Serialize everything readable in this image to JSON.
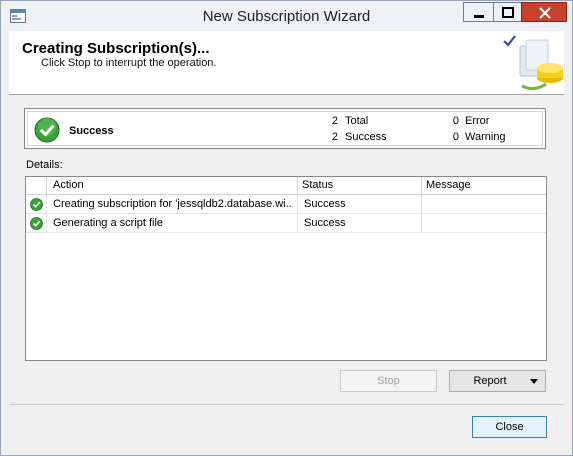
{
  "window": {
    "title": "New Subscription Wizard"
  },
  "header": {
    "title": "Creating Subscription(s)...",
    "subtitle": "Click Stop to interrupt the operation."
  },
  "summary": {
    "status": "Success",
    "total_count": "2",
    "total_label": "Total",
    "success_count": "2",
    "success_label": "Success",
    "error_count": "0",
    "error_label": "Error",
    "warning_count": "0",
    "warning_label": "Warning"
  },
  "details": {
    "label": "Details:",
    "columns": [
      "Action",
      "Status",
      "Message"
    ],
    "rows": [
      {
        "action": "Creating subscription for 'jessqldb2.database.wi...",
        "status": "Success",
        "message": ""
      },
      {
        "action": "Generating a script file",
        "status": "Success",
        "message": ""
      }
    ]
  },
  "buttons": {
    "stop": "Stop",
    "report": "Report",
    "close": "Close"
  },
  "colors": {
    "success_green": "#2e9a2e",
    "close_red": "#c7412c"
  },
  "icons": {
    "app": "wizard-app-icon",
    "status": "check-circle-icon",
    "header_art": "database-wizard-icon"
  }
}
